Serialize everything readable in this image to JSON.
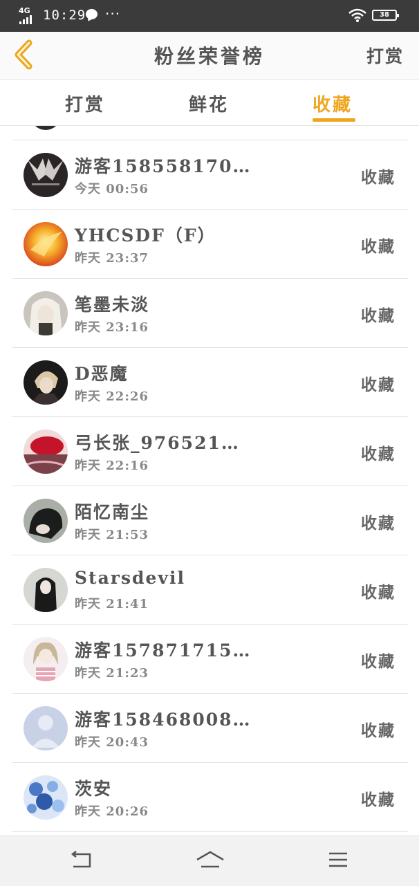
{
  "status_bar": {
    "network": "4G",
    "time": "10:29",
    "dots": "···",
    "battery": "38"
  },
  "header": {
    "title": "粉丝荣誉榜",
    "right_link": "打赏"
  },
  "tabs": [
    {
      "label": "打赏",
      "active": false
    },
    {
      "label": "鲜花",
      "active": false
    },
    {
      "label": "收藏",
      "active": true
    }
  ],
  "colors": {
    "accent": "#f0a51e",
    "status_bar": "#3b3b3b"
  },
  "fans": [
    {
      "name": "游客158558170…",
      "time": "今天 00:56",
      "action": "收藏",
      "avatar": "wolf-avatar"
    },
    {
      "name": "YHCSDF（F）",
      "time": "昨天 23:37",
      "action": "收藏",
      "avatar": "phoenix-avatar"
    },
    {
      "name": "笔墨未淡",
      "time": "昨天 23:16",
      "action": "收藏",
      "avatar": "anime-white-hair-avatar"
    },
    {
      "name": "D恶魔",
      "time": "昨天 22:26",
      "action": "收藏",
      "avatar": "anime-boy-avatar"
    },
    {
      "name": "弓长张_976521…",
      "time": "昨天 22:16",
      "action": "收藏",
      "avatar": "red-umbrella-avatar"
    },
    {
      "name": "陌忆南尘",
      "time": "昨天 21:53",
      "action": "收藏",
      "avatar": "dark-hair-avatar"
    },
    {
      "name": "Starsdevil",
      "time": "昨天 21:41",
      "action": "收藏",
      "avatar": "girl-black-hair-avatar"
    },
    {
      "name": "游客157871715…",
      "time": "昨天 21:23",
      "action": "收藏",
      "avatar": "anime-girl-pink-avatar"
    },
    {
      "name": "游客158468008…",
      "time": "昨天 20:43",
      "action": "收藏",
      "avatar": "default-user-avatar"
    },
    {
      "name": "茨安",
      "time": "昨天 20:26",
      "action": "收藏",
      "avatar": "blue-flowers-avatar"
    }
  ]
}
